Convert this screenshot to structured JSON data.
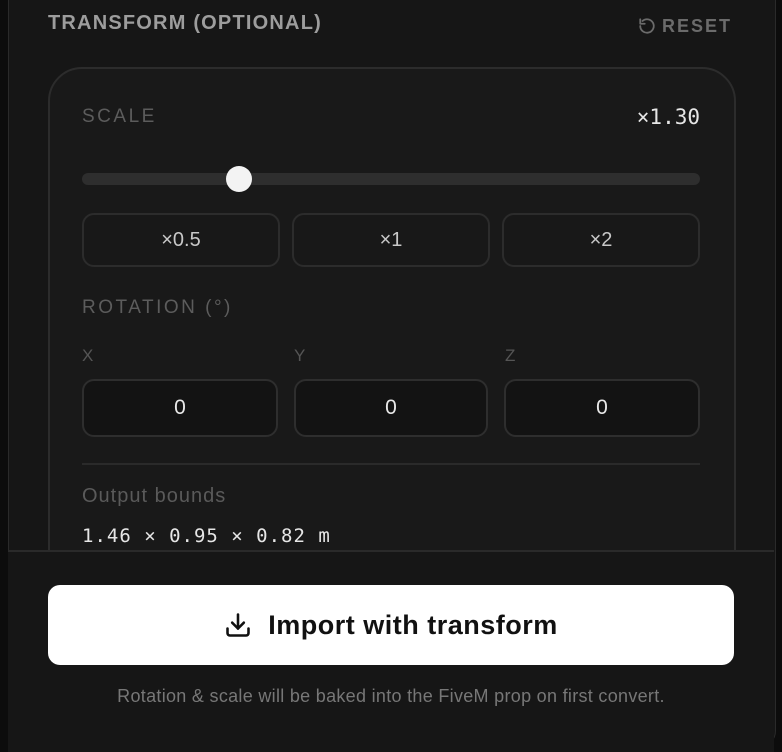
{
  "header": {
    "title": "TRANSFORM (OPTIONAL)",
    "reset_label": "RESET",
    "reset_icon": "rotate-ccw-icon"
  },
  "scale": {
    "label": "SCALE",
    "value_display": "×1.30",
    "value": 1.3,
    "slider_fraction": 0.254,
    "presets": [
      "×0.5",
      "×1",
      "×2"
    ]
  },
  "rotation": {
    "label": "ROTATION (°)",
    "axes": [
      {
        "label": "X",
        "value": "0"
      },
      {
        "label": "Y",
        "value": "0"
      },
      {
        "label": "Z",
        "value": "0"
      }
    ]
  },
  "bounds": {
    "label": "Output bounds",
    "value": "1.46 × 0.95 × 0.82 m"
  },
  "footer": {
    "import_label": "Import with transform",
    "import_icon": "download-icon",
    "hint": "Rotation & scale will be baked into the FiveM prop on first convert."
  }
}
